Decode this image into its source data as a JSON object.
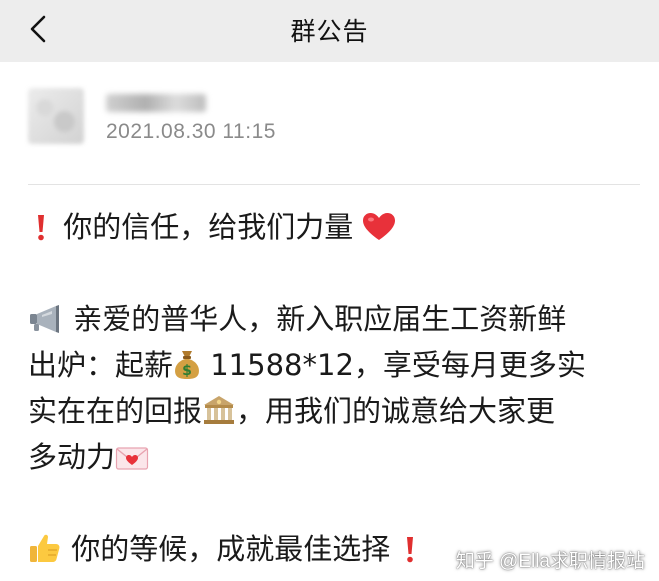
{
  "header": {
    "title": "群公告",
    "back_icon": "chevron-left-icon"
  },
  "announcement": {
    "timestamp": "2021.08.30  11:15",
    "lines": [
      {
        "icon": "exclamation-icon",
        "text": "你的信任，给我们力量",
        "trailing_icon": "red-heart-icon"
      },
      {
        "icon": "megaphone-icon",
        "text": "亲爱的普华人，新入职应届生工资新鲜"
      },
      {
        "text_before": "出炉：起薪",
        "icon": "money-bag-icon",
        "text": " 11588*12，享受每月更多实"
      },
      {
        "text": "实在在的回报",
        "trailing_icon": "bank-icon",
        "text_after": "，用我们的诚意给大家更"
      },
      {
        "text": "多动力",
        "trailing_icon": "love-letter-icon"
      },
      {
        "icon": "thumbs-up-icon",
        "text": "你的等候，成就最佳选择",
        "trailing_icon": "exclamation-icon"
      }
    ]
  },
  "watermark": "知乎 @Ella求职情报站",
  "colors": {
    "nav_background": "#ededed",
    "timestamp": "#8a8a8a",
    "accent_red": "#e02f2f"
  }
}
